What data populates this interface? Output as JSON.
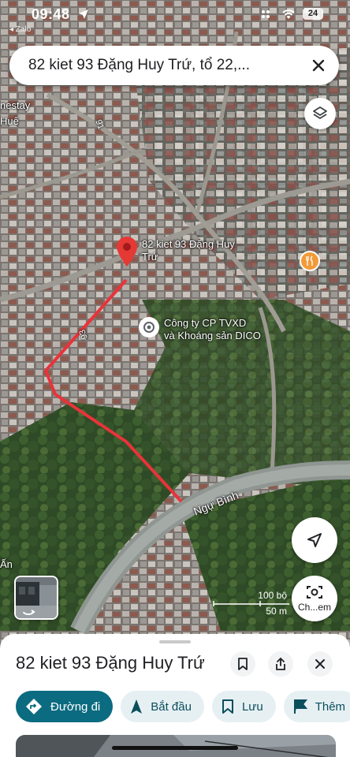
{
  "status_bar": {
    "time": "09:48",
    "back_app": "◂ Zalo",
    "battery": "24"
  },
  "search": {
    "query": "82 kiet 93 Đặng Huy Trứ, tổ 22,..."
  },
  "map": {
    "pin_label": [
      "82 kiet 93 Đặng Huy",
      "Trứ"
    ],
    "poi_label": [
      "Công ty CP TVXD",
      "và Khoáng sản DICO"
    ],
    "road_label": "Ngự Bình",
    "street_93": "93",
    "street_91": "91",
    "edge_label_1": "nestay",
    "edge_label_2": "Huế",
    "edge_label_3": "Ấn",
    "scale_top": "100 bộ",
    "scale_bottom": "50 m",
    "lens_label": "Ch...em",
    "route_color": "#e8333a",
    "pin_color": "#e53935",
    "food_pin_color": "#f29a38"
  },
  "place": {
    "title": "82 kiet 93 Đặng Huy Trứ"
  },
  "actions": {
    "directions": "Đường đi",
    "start": "Bắt đầu",
    "save": "Lưu",
    "more": "Thêm"
  },
  "colors": {
    "primary_chip": "#0b6b80",
    "secondary_chip": "#e6f0f3"
  }
}
